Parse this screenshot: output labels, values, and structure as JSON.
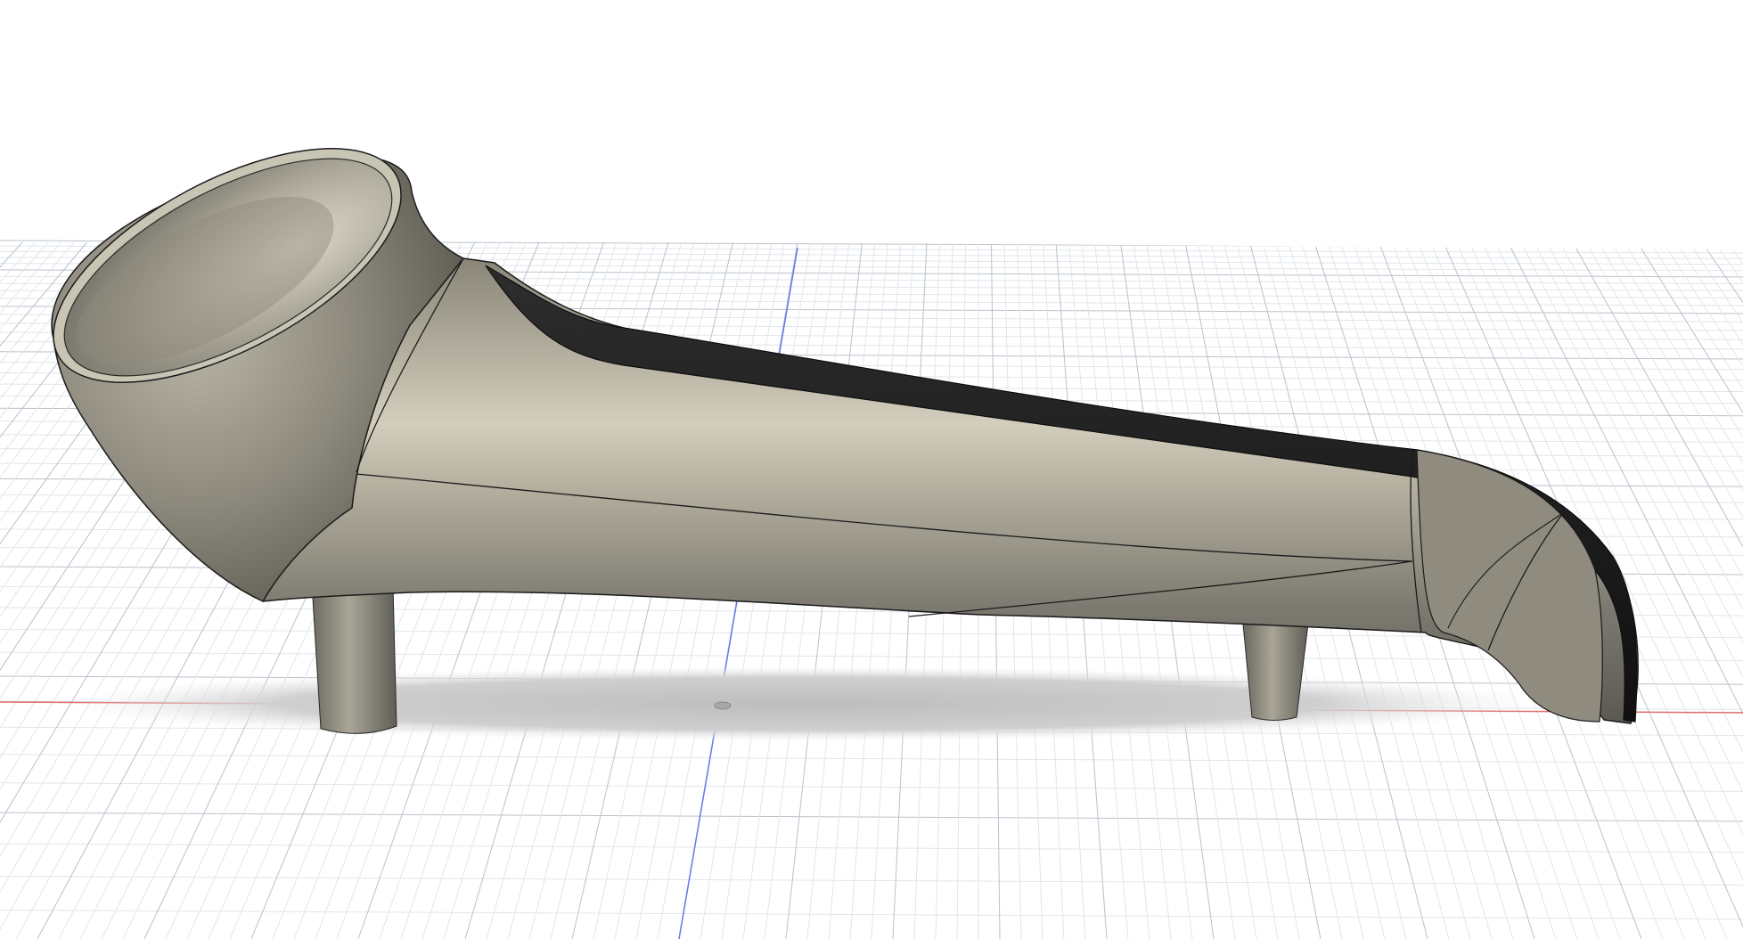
{
  "viewport": {
    "background_color": "#ffffff",
    "grid": {
      "visible": true,
      "major_color": "#b9c2cb",
      "minor_color": "#e1e6eb"
    },
    "axes": {
      "x_axis_color": "#e06a6a",
      "y_axis_color": "#6a78e8"
    },
    "origin_marker": "origin-point"
  },
  "model": {
    "body_color": "#9b9788",
    "highlight_color": "#d6d2c2",
    "shadow_color": "#5e5c55",
    "channel_color": "#1b1b1b",
    "edge_color": "#141414",
    "ground_shadow_color": "#c4c4c4",
    "part_count": 1,
    "leg_count": 2
  }
}
